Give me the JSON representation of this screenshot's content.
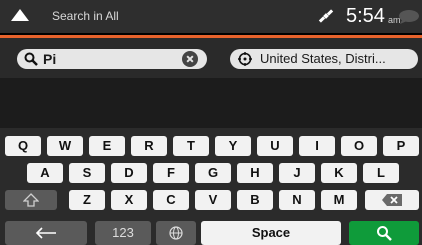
{
  "header": {
    "title": "Search in All",
    "time": "5:54",
    "ampm": "am"
  },
  "search": {
    "query": "Pi",
    "country": "United States, Distri..."
  },
  "keyboard": {
    "row1": [
      "Q",
      "W",
      "E",
      "R",
      "T",
      "Y",
      "U",
      "I",
      "O",
      "P"
    ],
    "row2": [
      "A",
      "S",
      "D",
      "F",
      "G",
      "H",
      "J",
      "K",
      "L"
    ],
    "row3": [
      "Z",
      "X",
      "C",
      "V",
      "B",
      "N",
      "M"
    ],
    "numbers_label": "123",
    "space_label": "Space"
  },
  "colors": {
    "accent": "#e8632c",
    "go": "#0f9b3a",
    "bar": "#2e2e2e"
  }
}
